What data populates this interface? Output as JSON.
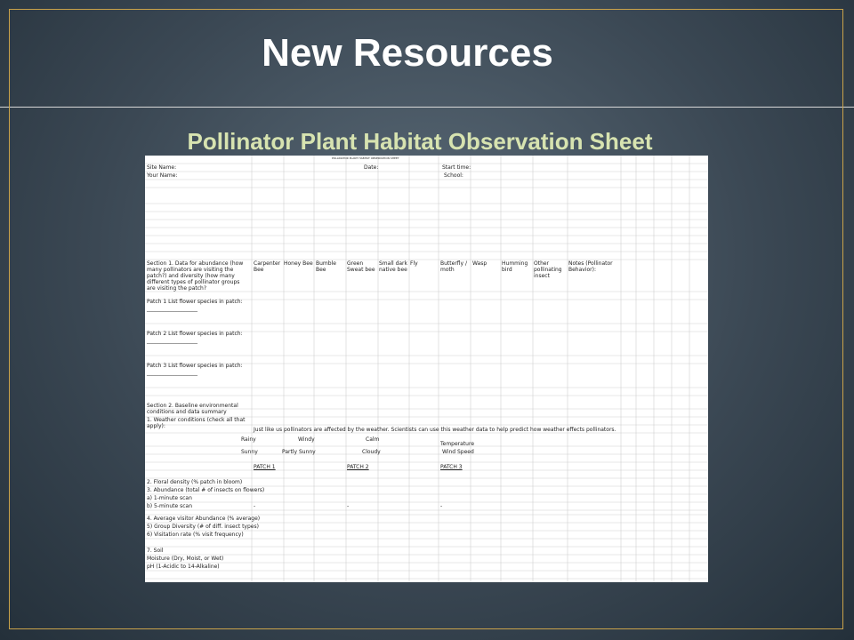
{
  "slide": {
    "title": "New Resources",
    "subtitle": "Pollinator Plant Habitat Observation Sheet"
  },
  "sheet": {
    "header_note": "POLLINATOR PLANT HABITAT OBSERVATION SHEET",
    "site_name": "Site Name:",
    "date": "Date:",
    "start_time": "Start time:",
    "your_name": "Your Name:",
    "school": "School:",
    "section1": "Section 1. Data for abundance (how many pollinators are visiting the patch?) and diversity (how many different types of pollinator groups are visiting the patch?",
    "columns": [
      "Carpenter Bee",
      "Honey Bee",
      "Bumble Bee",
      "Green Sweat bee",
      "Small dark native bee",
      "Fly",
      "Butterfly / moth",
      "Wasp",
      "Humming bird",
      "Other pollinating insect",
      "Notes (Pollinator Behavior):"
    ],
    "patch1": "Patch 1  List flower species in patch:",
    "patch2": "Patch 2  List flower species in patch:",
    "patch3": "Patch 3  List flower species in patch:",
    "blank_line": "___________________",
    "section2": "Section 2. Baseline environmental conditions and data summary",
    "weather_q": "1. Weather conditions (check all that apply):",
    "weather_note": "Just like us pollinators are affected by the weather. Scientists can use this weather data to help predict how weather effects pollinators.",
    "rainy": "Rainy",
    "windy": "Windy",
    "calm": "Calm",
    "temperature": "Temperature",
    "sunny": "Sunny",
    "partly_sunny": "Partly Sunny",
    "cloudy": "Cloudy",
    "wind_speed": "Wind Speed",
    "patch_headers": [
      "PATCH 1",
      "PATCH 2",
      "PATCH 3"
    ],
    "q2": "2. Floral density (% patch in bloom)",
    "q3": "3. Abundance (total # of insects on flowers)",
    "q3a": "a) 1-minute scan",
    "q3b": "b) 5-minute scan",
    "dash": "-",
    "q4": "4. Average visitor Abundance (% average)",
    "q5": "5) Group Diversity (# of diff. insect types)",
    "q6": "6) Visitation rate (% visit frequency)",
    "q7": "7. Soil",
    "moisture": "Moisture (Dry, Moist, or Wet)",
    "ph": "pH (1-Acidic to 14-Alkaline)"
  }
}
